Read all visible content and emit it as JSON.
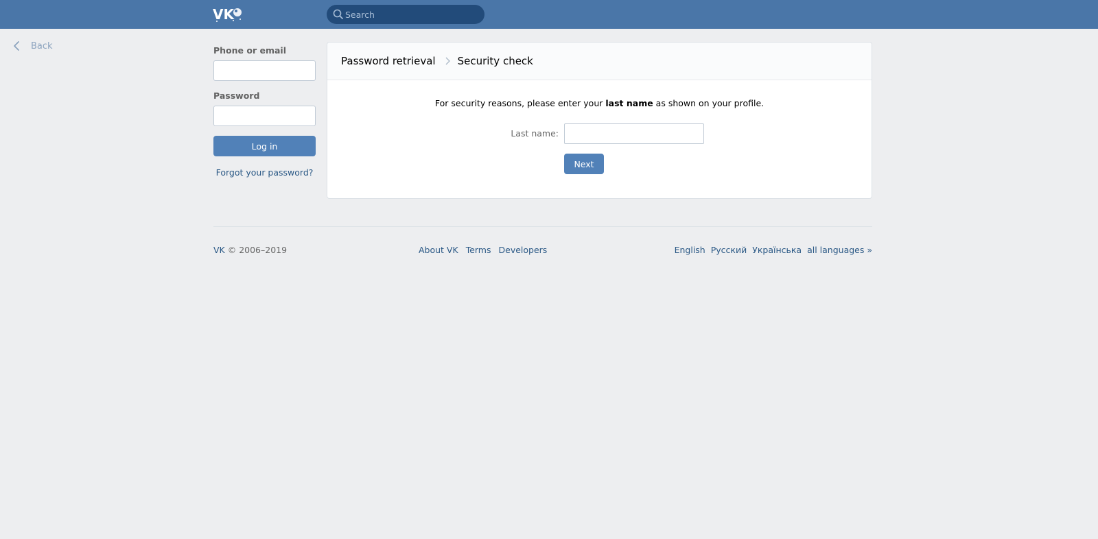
{
  "header": {
    "logo_text": "VK",
    "search_placeholder": "Search",
    "bar_color": "#4a76a8"
  },
  "nav": {
    "back_label": "Back"
  },
  "login": {
    "phone_label": "Phone or email",
    "phone_value": "",
    "password_label": "Password",
    "password_value": "",
    "login_button": "Log in",
    "forgot_link": "Forgot your password?"
  },
  "main": {
    "breadcrumb": {
      "parent": "Password retrieval",
      "current": "Security check"
    },
    "notice_before": "For security reasons, please enter your ",
    "notice_bold": "last name",
    "notice_after": " as shown on your profile.",
    "lastname_label": "Last name:",
    "lastname_value": "",
    "next_button": "Next"
  },
  "footer": {
    "brand": "VK",
    "copyright": " © 2006–2019",
    "links": [
      "About VK",
      "Terms",
      "Developers"
    ],
    "languages": [
      "English",
      "Русский",
      "Українська",
      "all languages »"
    ]
  },
  "colors": {
    "accent": "#5181b8",
    "link": "#2a5885",
    "background": "#edeef0"
  }
}
